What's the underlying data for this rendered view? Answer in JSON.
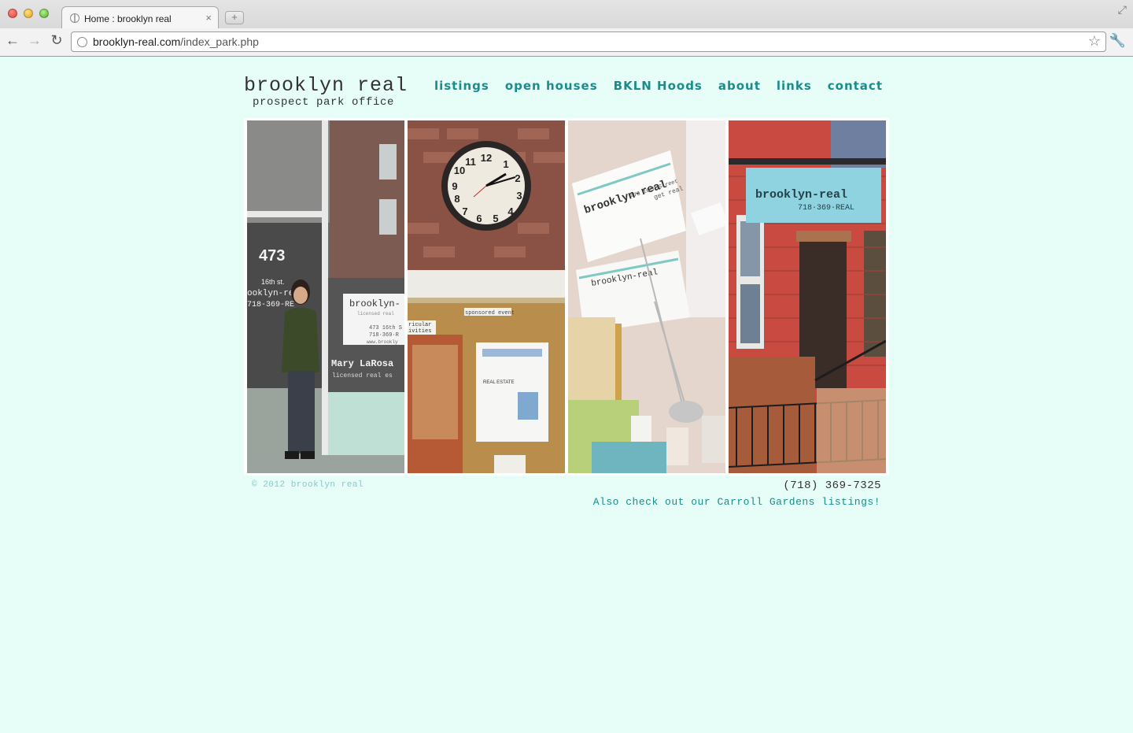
{
  "browser": {
    "tab_title": "Home : brooklyn real",
    "tab_close": "×",
    "new_tab": "+",
    "url_host": "brooklyn-real.com",
    "url_path": "/index_park.php"
  },
  "site": {
    "brand_name": "brooklyn real",
    "brand_sub": "prospect park office"
  },
  "nav": [
    "listings",
    "open houses",
    "BKLN Hoods",
    "about",
    "links",
    "contact"
  ],
  "photos": {
    "storefront": {
      "number": "473",
      "street": "16th st.",
      "name_line": "ooklyn-re",
      "phone_line": "718-369-RE",
      "sign_brand": "brooklyn-",
      "sign_sub": "licensed real",
      "sign_addr": "473 16th S",
      "sign_phone": "718·369·R",
      "sign_web": "www.brookly",
      "agent": "Mary LaRosa",
      "agent_title": "licensed real es"
    },
    "clock": {
      "sponsored": "sponsored event",
      "curricular": "ricular",
      "activities": "ivities",
      "real_estate": "REAL ESTATE"
    },
    "cards": {
      "brand": "brooklyn-real",
      "address": "473 16th Street",
      "tagline": "get real"
    },
    "sign": {
      "brand": "brooklyn-real",
      "phone": "718·369·REAL"
    }
  },
  "footer": {
    "copyright": "© 2012 brooklyn real",
    "phone": "(718) 369-7325",
    "also": "Also check out our Carroll Gardens listings!"
  }
}
